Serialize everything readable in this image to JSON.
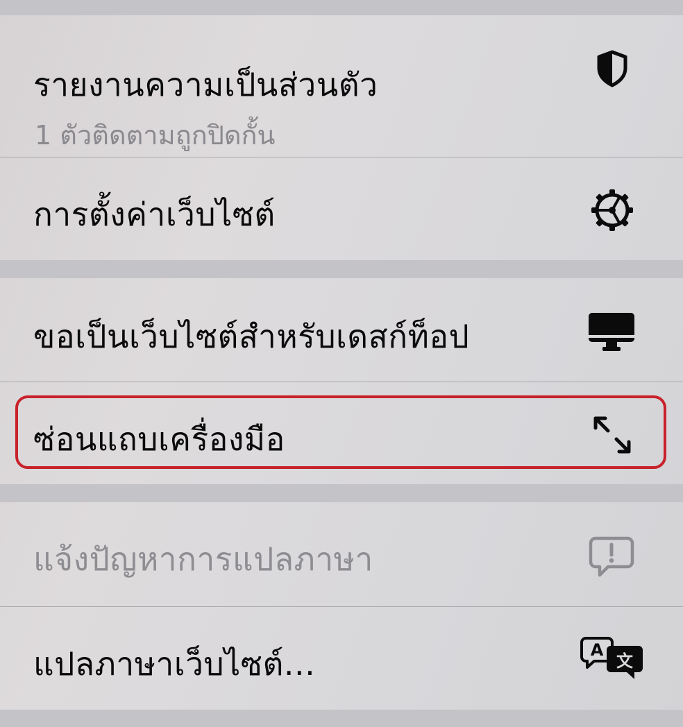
{
  "menu": {
    "items": [
      {
        "label": "รายงานความเป็นส่วนตัว",
        "sublabel": "1 ตัวติดตามถูกปิดกั้น",
        "icon": "shield-half-icon",
        "enabled": true
      },
      {
        "label": "การตั้งค่าเว็บไซต์",
        "icon": "gear-icon",
        "enabled": true
      },
      {
        "label": "ขอเป็นเว็บไซต์สำหรับเดสก์ท็อป",
        "icon": "desktop-monitor-icon",
        "enabled": true
      },
      {
        "label": "ซ่อนแถบเครื่องมือ",
        "icon": "expand-arrows-icon",
        "enabled": true,
        "highlighted": true
      },
      {
        "label": "แจ้งปัญหาการแปลภาษา",
        "icon": "exclamation-bubble-icon",
        "enabled": false
      },
      {
        "label": "แปลภาษาเว็บไซต์...",
        "icon": "translate-icon",
        "enabled": true
      }
    ]
  },
  "colors": {
    "highlight_border": "#c8222b",
    "text_primary": "#0b0b0c",
    "text_secondary": "#8a898e",
    "text_disabled": "#8e8d92"
  }
}
